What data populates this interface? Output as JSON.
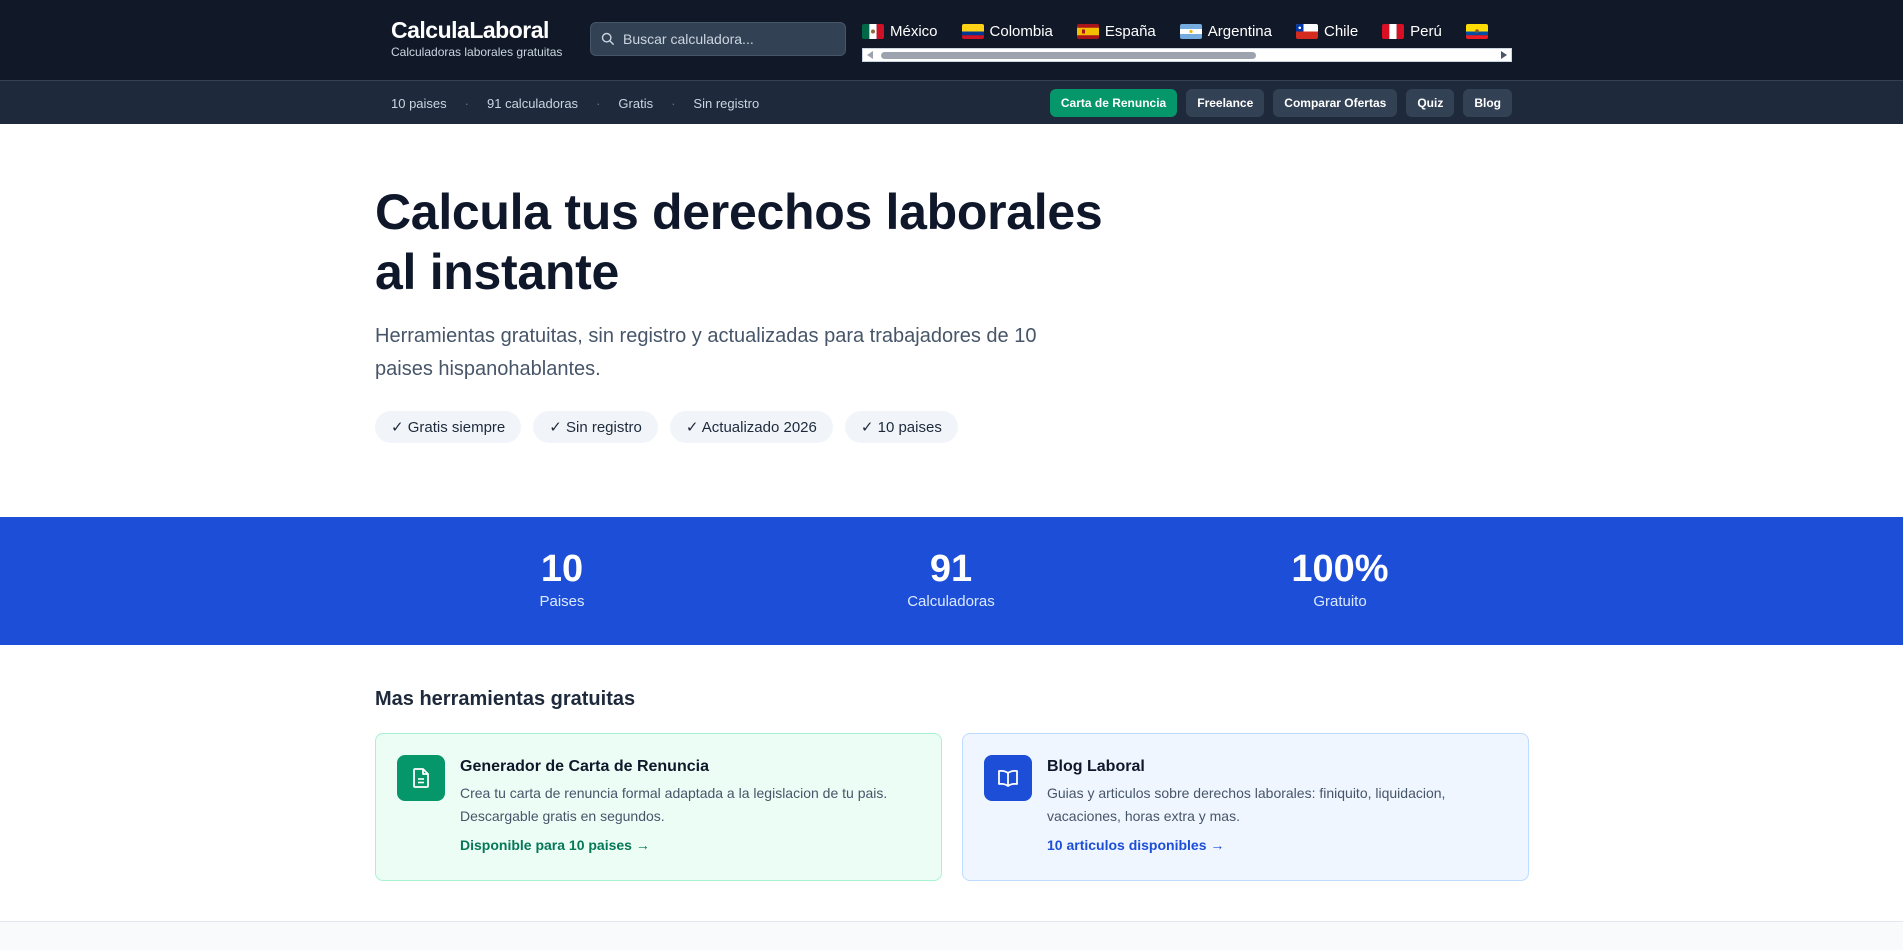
{
  "header": {
    "brand_title": "CalculaLaboral",
    "brand_subtitle": "Calculadoras laborales gratuitas",
    "search_placeholder": "Buscar calculadora...",
    "countries": [
      {
        "name": "México",
        "flag": "mexico-flag-icon"
      },
      {
        "name": "Colombia",
        "flag": "colombia-flag-icon"
      },
      {
        "name": "España",
        "flag": "spain-flag-icon"
      },
      {
        "name": "Argentina",
        "flag": "argentina-flag-icon"
      },
      {
        "name": "Chile",
        "flag": "chile-flag-icon"
      },
      {
        "name": "Perú",
        "flag": "peru-flag-icon"
      },
      {
        "name": "",
        "flag": "ecuador-flag-icon"
      }
    ],
    "colors": {
      "background": "#111827",
      "search_bg": "#334155"
    }
  },
  "subbar": {
    "stats": [
      "10 paises",
      "91 calculadoras",
      "Gratis",
      "Sin registro"
    ],
    "nav": [
      {
        "label": "Carta de Renuncia",
        "highlight": true
      },
      {
        "label": "Freelance",
        "highlight": false
      },
      {
        "label": "Comparar Ofertas",
        "highlight": false
      },
      {
        "label": "Quiz",
        "highlight": false
      },
      {
        "label": "Blog",
        "highlight": false
      }
    ],
    "colors": {
      "background": "#1e293b",
      "accent": "#059669"
    }
  },
  "hero": {
    "title_line1": "Calcula tus derechos laborales",
    "title_line2": "al instante",
    "subtitle": "Herramientas gratuitas, sin registro y actualizadas para trabajadores de 10 paises hispanohablantes.",
    "badges": [
      "✓ Gratis siempre",
      "✓ Sin registro",
      "✓ Actualizado 2026",
      "✓ 10 paises"
    ]
  },
  "stats": {
    "color": "#1d4ed8",
    "items": [
      {
        "value": "10",
        "label": "Paises"
      },
      {
        "value": "91",
        "label": "Calculadoras"
      },
      {
        "value": "100%",
        "label": "Gratuito"
      }
    ]
  },
  "tools": {
    "title": "Mas herramientas gratuitas",
    "cards": [
      {
        "icon": "document-icon",
        "title": "Generador de Carta de Renuncia",
        "description": "Crea tu carta de renuncia formal adaptada a la legislacion de tu pais. Descargable gratis en segundos.",
        "link": "Disponible para 10 paises →"
      },
      {
        "icon": "book-icon",
        "title": "Blog Laboral",
        "description": "Guias y articulos sobre derechos laborales: finiquito, liquidacion, vacaciones, horas extra y mas.",
        "link": "10 articulos disponibles →"
      }
    ]
  }
}
